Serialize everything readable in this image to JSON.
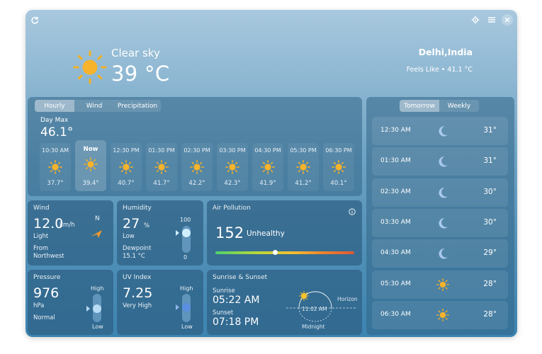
{
  "toolbar": {
    "refresh_icon": "refresh-icon",
    "location_icon": "location-target-icon",
    "menu_icon": "hamburger-menu-icon",
    "close_icon": "close-icon"
  },
  "current": {
    "condition": "Clear sky",
    "temperature": "39 °C",
    "location": "Delhi,India",
    "feels_like": "Feels Like • 41.1 °C"
  },
  "hourly_tabs": [
    "Hourly",
    "Wind",
    "Precipitation"
  ],
  "hourly_active": 0,
  "day_max_label": "Day Max",
  "day_max_value": "46.1°",
  "hourly": [
    {
      "time": "10:30 AM",
      "temp": "37.7°"
    },
    {
      "time": "Now",
      "temp": "39.4°"
    },
    {
      "time": "12:30 PM",
      "temp": "40.7°"
    },
    {
      "time": "01:30 PM",
      "temp": "41.7°"
    },
    {
      "time": "02:30 PM",
      "temp": "42.2°"
    },
    {
      "time": "03:30 PM",
      "temp": "42.3°"
    },
    {
      "time": "04:30 PM",
      "temp": "41.9°"
    },
    {
      "time": "05:30 PM",
      "temp": "41.2°"
    },
    {
      "time": "06:30 PM",
      "temp": "40.1°"
    }
  ],
  "forecast_tabs": [
    "Tomorrow",
    "Weekly"
  ],
  "forecast_active": 0,
  "forecast": [
    {
      "time": "12:30 AM",
      "icon": "moon-icon",
      "temp": "31°"
    },
    {
      "time": "01:30 AM",
      "icon": "moon-icon",
      "temp": "31°"
    },
    {
      "time": "02:30 AM",
      "icon": "moon-icon",
      "temp": "30°"
    },
    {
      "time": "03:30 AM",
      "icon": "moon-icon",
      "temp": "30°"
    },
    {
      "time": "04:30 AM",
      "icon": "moon-icon",
      "temp": "29°"
    },
    {
      "time": "05:30 AM",
      "icon": "sun-icon",
      "temp": "28°"
    },
    {
      "time": "06:30 AM",
      "icon": "sun-icon",
      "temp": "28°"
    }
  ],
  "wind": {
    "title": "Wind",
    "speed": "12.0",
    "unit": "km/h",
    "desc": "Light",
    "direction_letter": "N",
    "from_label": "From",
    "from_value": "Northwest"
  },
  "humidity": {
    "title": "Humidity",
    "value": "27",
    "unit": "%",
    "desc": "Low",
    "dewpoint_label": "Dewpoint",
    "dewpoint_value": "15.1 °C",
    "scale_max": "100",
    "scale_min": "0",
    "level": 0.27
  },
  "air": {
    "title": "Air Pollution",
    "value": "152",
    "desc": "Unhealthy",
    "level": 0.43
  },
  "pressure": {
    "title": "Pressure",
    "value": "976",
    "unit": "hPa",
    "desc": "Normal",
    "scale_high": "High",
    "scale_low": "Low",
    "level": 0.45
  },
  "uv": {
    "title": "UV Index",
    "value": "7.25",
    "desc": "Very High",
    "scale_high": "High",
    "scale_low": "Low",
    "level": 0.55
  },
  "sun": {
    "title": "Sunrise & Sunset",
    "sunrise_label": "Sunrise",
    "sunrise": "05:22 AM",
    "sunset_label": "Sunset",
    "sunset": "07:18 PM",
    "noon": "11:02 AM",
    "horizon": "Horizon",
    "midnight": "Midnight"
  },
  "colors": {
    "sun": "#f5b020",
    "sun_core": "#f7b32b",
    "moon": "#a9c9ee",
    "knob": "#cfefff",
    "accent_blue": "#5a8fe0"
  }
}
